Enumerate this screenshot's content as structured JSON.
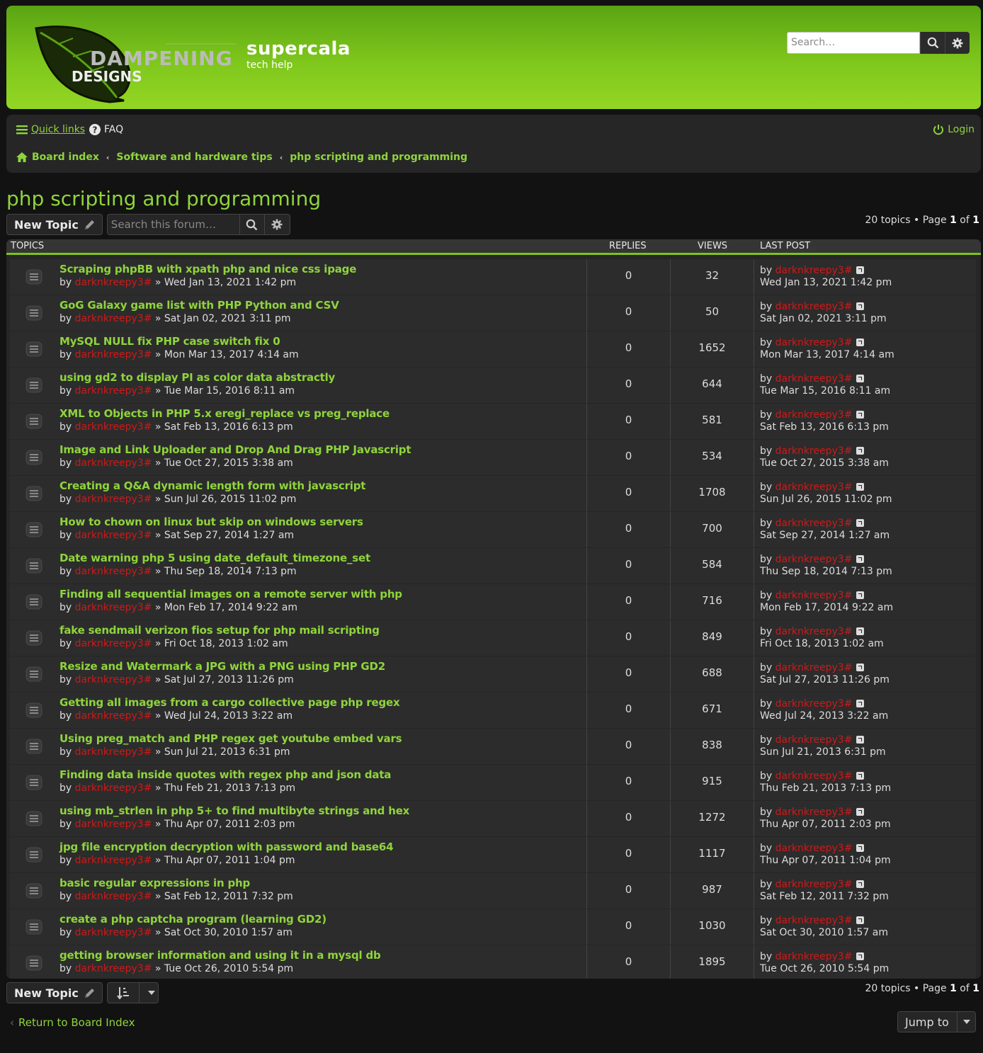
{
  "header": {
    "logo_line1": "DAMPENING",
    "logo_line2": "DESIGNS",
    "site_title": "supercala",
    "site_description": "tech help",
    "search_placeholder": "Search…"
  },
  "nav": {
    "quick_links": "Quick links",
    "faq": "FAQ",
    "login": "Login",
    "breadcrumbs": [
      "Board index",
      "Software and hardware tips",
      "php scripting and programming"
    ]
  },
  "forum": {
    "title": "php scripting and programming",
    "new_topic": "New Topic",
    "search_placeholder": "Search this forum…",
    "pagination_count": "20 topics",
    "page_label": "Page",
    "page_current": "1",
    "page_of": "of",
    "page_total": "1"
  },
  "table": {
    "headers": {
      "topics": "TOPICS",
      "replies": "REPLIES",
      "views": "VIEWS",
      "last_post": "LAST POST"
    },
    "by": "by",
    "raquo": "»",
    "rows": [
      {
        "title": "Scraping phpBB with xpath php and nice css ipage",
        "author": "darknkreepy3#",
        "date": "Wed Jan 13, 2021 1:42 pm",
        "replies": "0",
        "views": "32",
        "last_author": "darknkreepy3#",
        "last_date": "Wed Jan 13, 2021 1:42 pm"
      },
      {
        "title": "GoG Galaxy game list with PHP Python and CSV",
        "author": "darknkreepy3#",
        "date": "Sat Jan 02, 2021 3:11 pm",
        "replies": "0",
        "views": "50",
        "last_author": "darknkreepy3#",
        "last_date": "Sat Jan 02, 2021 3:11 pm"
      },
      {
        "title": "MySQL NULL fix PHP case switch fix 0",
        "author": "darknkreepy3#",
        "date": "Mon Mar 13, 2017 4:14 am",
        "replies": "0",
        "views": "1652",
        "last_author": "darknkreepy3#",
        "last_date": "Mon Mar 13, 2017 4:14 am"
      },
      {
        "title": "using gd2 to display PI as color data abstractly",
        "author": "darknkreepy3#",
        "date": "Tue Mar 15, 2016 8:11 am",
        "replies": "0",
        "views": "644",
        "last_author": "darknkreepy3#",
        "last_date": "Tue Mar 15, 2016 8:11 am"
      },
      {
        "title": "XML to Objects in PHP 5.x eregi_replace vs preg_replace",
        "author": "darknkreepy3#",
        "date": "Sat Feb 13, 2016 6:13 pm",
        "replies": "0",
        "views": "581",
        "last_author": "darknkreepy3#",
        "last_date": "Sat Feb 13, 2016 6:13 pm"
      },
      {
        "title": "Image and Link Uploader and Drop And Drag PHP Javascript",
        "author": "darknkreepy3#",
        "date": "Tue Oct 27, 2015 3:38 am",
        "replies": "0",
        "views": "534",
        "last_author": "darknkreepy3#",
        "last_date": "Tue Oct 27, 2015 3:38 am"
      },
      {
        "title": "Creating a Q&A dynamic length form with javascript",
        "author": "darknkreepy3#",
        "date": "Sun Jul 26, 2015 11:02 pm",
        "replies": "0",
        "views": "1708",
        "last_author": "darknkreepy3#",
        "last_date": "Sun Jul 26, 2015 11:02 pm"
      },
      {
        "title": "How to chown on linux but skip on windows servers",
        "author": "darknkreepy3#",
        "date": "Sat Sep 27, 2014 1:27 am",
        "replies": "0",
        "views": "700",
        "last_author": "darknkreepy3#",
        "last_date": "Sat Sep 27, 2014 1:27 am"
      },
      {
        "title": "Date warning php 5 using date_default_timezone_set",
        "author": "darknkreepy3#",
        "date": "Thu Sep 18, 2014 7:13 pm",
        "replies": "0",
        "views": "584",
        "last_author": "darknkreepy3#",
        "last_date": "Thu Sep 18, 2014 7:13 pm"
      },
      {
        "title": "Finding all sequential images on a remote server with php",
        "author": "darknkreepy3#",
        "date": "Mon Feb 17, 2014 9:22 am",
        "replies": "0",
        "views": "716",
        "last_author": "darknkreepy3#",
        "last_date": "Mon Feb 17, 2014 9:22 am"
      },
      {
        "title": "fake sendmail verizon fios setup for php mail scripting",
        "author": "darknkreepy3#",
        "date": "Fri Oct 18, 2013 1:02 am",
        "replies": "0",
        "views": "849",
        "last_author": "darknkreepy3#",
        "last_date": "Fri Oct 18, 2013 1:02 am"
      },
      {
        "title": "Resize and Watermark a JPG with a PNG using PHP GD2",
        "author": "darknkreepy3#",
        "date": "Sat Jul 27, 2013 11:26 pm",
        "replies": "0",
        "views": "688",
        "last_author": "darknkreepy3#",
        "last_date": "Sat Jul 27, 2013 11:26 pm"
      },
      {
        "title": "Getting all images from a cargo collective page php regex",
        "author": "darknkreepy3#",
        "date": "Wed Jul 24, 2013 3:22 am",
        "replies": "0",
        "views": "671",
        "last_author": "darknkreepy3#",
        "last_date": "Wed Jul 24, 2013 3:22 am"
      },
      {
        "title": "Using preg_match and PHP regex get youtube embed vars",
        "author": "darknkreepy3#",
        "date": "Sun Jul 21, 2013 6:31 pm",
        "replies": "0",
        "views": "838",
        "last_author": "darknkreepy3#",
        "last_date": "Sun Jul 21, 2013 6:31 pm"
      },
      {
        "title": "Finding data inside quotes with regex php and json data",
        "author": "darknkreepy3#",
        "date": "Thu Feb 21, 2013 7:13 pm",
        "replies": "0",
        "views": "915",
        "last_author": "darknkreepy3#",
        "last_date": "Thu Feb 21, 2013 7:13 pm"
      },
      {
        "title": "using mb_strlen in php 5+ to find multibyte strings and hex",
        "author": "darknkreepy3#",
        "date": "Thu Apr 07, 2011 2:03 pm",
        "replies": "0",
        "views": "1272",
        "last_author": "darknkreepy3#",
        "last_date": "Thu Apr 07, 2011 2:03 pm"
      },
      {
        "title": "jpg file encryption decryption with password and base64",
        "author": "darknkreepy3#",
        "date": "Thu Apr 07, 2011 1:04 pm",
        "replies": "0",
        "views": "1117",
        "last_author": "darknkreepy3#",
        "last_date": "Thu Apr 07, 2011 1:04 pm"
      },
      {
        "title": "basic regular expressions in php",
        "author": "darknkreepy3#",
        "date": "Sat Feb 12, 2011 7:32 pm",
        "replies": "0",
        "views": "987",
        "last_author": "darknkreepy3#",
        "last_date": "Sat Feb 12, 2011 7:32 pm"
      },
      {
        "title": "create a php captcha program (learning GD2)",
        "author": "darknkreepy3#",
        "date": "Sat Oct 30, 2010 1:57 am",
        "replies": "0",
        "views": "1030",
        "last_author": "darknkreepy3#",
        "last_date": "Sat Oct 30, 2010 1:57 am"
      },
      {
        "title": "getting browser information and using it in a mysql db",
        "author": "darknkreepy3#",
        "date": "Tue Oct 26, 2010 5:54 pm",
        "replies": "0",
        "views": "1895",
        "last_author": "darknkreepy3#",
        "last_date": "Tue Oct 26, 2010 5:54 pm"
      }
    ]
  },
  "footer": {
    "return_link": "Return to Board Index",
    "jump_to": "Jump to"
  },
  "colors": {
    "accent_green": "#8fd43c",
    "author_red": "#cc1a1a",
    "header_gradient_top": "#5aa413",
    "header_gradient_bottom": "#94d624"
  },
  "icons": [
    "search-icon",
    "gear-icon",
    "hamburger-icon",
    "question-icon",
    "power-icon",
    "home-icon",
    "pencil-icon",
    "topic-read-icon",
    "goto-last-post-icon",
    "sort-icon",
    "chevron-left-icon",
    "caret-down-icon"
  ]
}
